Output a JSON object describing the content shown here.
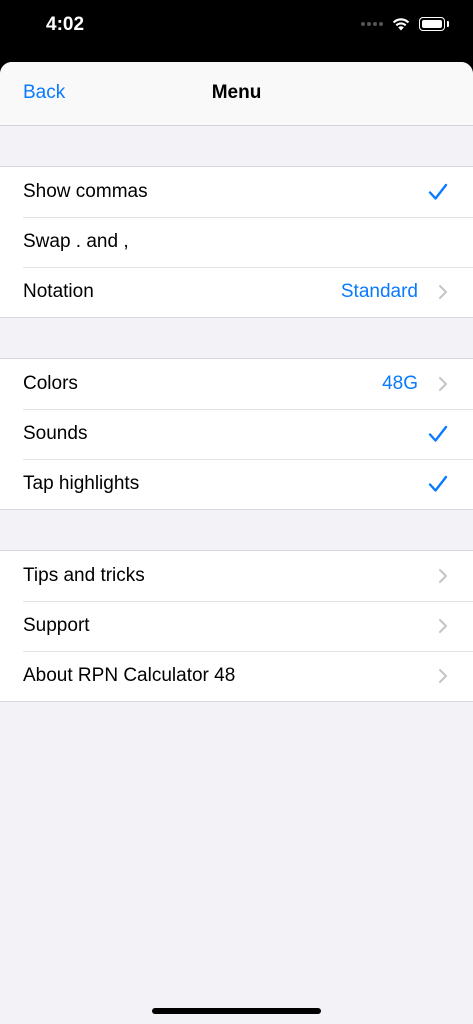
{
  "status": {
    "time": "4:02"
  },
  "nav": {
    "back": "Back",
    "title": "Menu"
  },
  "groups": [
    {
      "rows": [
        {
          "label": "Show commas",
          "accessory": "check-icon"
        },
        {
          "label": "Swap . and ,"
        },
        {
          "label": "Notation",
          "value": "Standard",
          "accessory": "chevron-right-icon"
        }
      ]
    },
    {
      "rows": [
        {
          "label": "Colors",
          "value": "48G",
          "accessory": "chevron-right-icon"
        },
        {
          "label": "Sounds",
          "accessory": "check-icon"
        },
        {
          "label": "Tap highlights",
          "accessory": "check-icon"
        }
      ]
    },
    {
      "rows": [
        {
          "label": "Tips and tricks",
          "accessory": "chevron-right-icon"
        },
        {
          "label": "Support",
          "accessory": "chevron-right-icon"
        },
        {
          "label": "About RPN Calculator 48",
          "accessory": "chevron-right-icon"
        }
      ]
    }
  ],
  "colors": {
    "accent": "#0a7aff",
    "background": "#f2f2f7",
    "chevron": "#c4c4c7"
  }
}
